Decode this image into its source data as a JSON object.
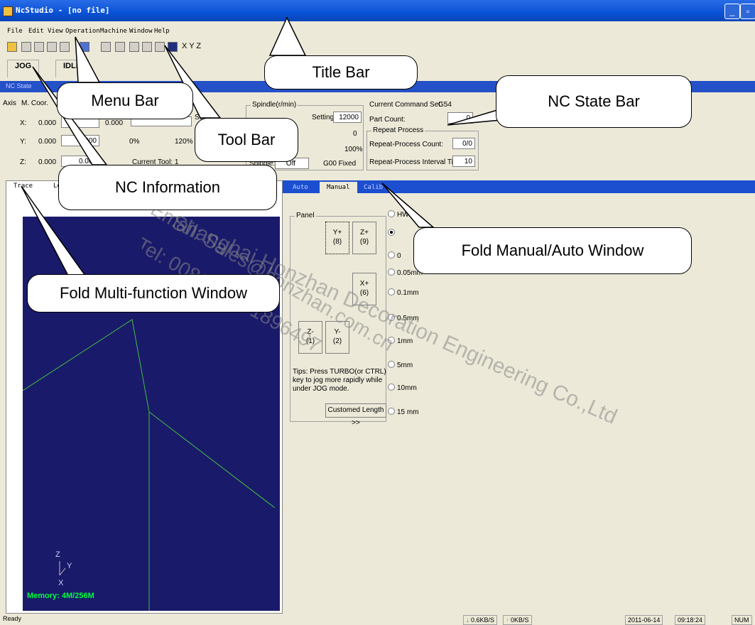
{
  "window": {
    "title": "NcStudio - [no file]"
  },
  "menu": [
    "File",
    "Edit",
    "View",
    "Operation",
    "Machine",
    "Window",
    "Help"
  ],
  "toolbar": {
    "axis_labels": "X   Y   Z"
  },
  "mode_tabs": [
    "JOG",
    "IDLE"
  ],
  "state_bar": {
    "label": "NC State"
  },
  "nc_info": {
    "axis_header": "Axis",
    "mcoor_header": "M. Coor.",
    "axes": [
      {
        "name": "X:",
        "mcoor": "0.000",
        "wcoor": "0.000"
      },
      {
        "name": "Y:",
        "mcoor": "0.000",
        "wcoor": "0.000"
      },
      {
        "name": "Z:",
        "mcoor": "0.000",
        "wcoor": "0.000"
      }
    ],
    "feed": {
      "setting_label": "Setting:",
      "pct_min": "0%",
      "pct_max": "120%",
      "current_tool": "Current Tool: 1"
    },
    "spindle": {
      "title": "Spindle(r/min)",
      "setting_label": "Setting:",
      "setting_value": "12000",
      "actual": "0",
      "percent": "100%",
      "spindle_label": "Spindle:",
      "spindle_state": "Off",
      "g00": "G00 Fixed"
    },
    "command": {
      "current_set_label": "Current Command Set:",
      "current_set_value": "G54",
      "part_count_label": "Part Count:",
      "part_count_value": "0",
      "repeat_title": "Repeat Process",
      "repeat_count_label": "Repeat-Process Count:",
      "repeat_count_value": "0/0",
      "repeat_interval_label": "Repeat-Process Interval Time:",
      "repeat_interval_value": "10"
    }
  },
  "left_panel": {
    "tabs": [
      "Trace",
      "Log"
    ],
    "memory": "Memory: 4M/256M",
    "axis_z": "Z",
    "axis_y": "Y",
    "axis_x": "X"
  },
  "right_panel": {
    "tabs": [
      "Auto",
      "Manual",
      "Calib"
    ],
    "panel_title": "Panel",
    "jog_buttons": [
      {
        "id": "yplus",
        "label": "Y+",
        "key": "(8)"
      },
      {
        "id": "zplus",
        "label": "Z+",
        "key": "(9)"
      },
      {
        "id": "xplus",
        "label": "X+",
        "key": "(6)"
      },
      {
        "id": "zminus",
        "label": "Z-",
        "key": "(1)"
      },
      {
        "id": "yminus",
        "label": "Y-",
        "key": "(2)"
      }
    ],
    "step_options": [
      "HW",
      "",
      "0",
      "0.05mm",
      "0.1mm",
      "0.5mm",
      "1mm",
      "5mm",
      "10mm",
      "15 mm"
    ],
    "tips": "Tips: Press TURBO(or CTRL) key to jog more rapidly while under JOG mode.",
    "customed_length": "Customed Length  >>"
  },
  "status_bar": {
    "ready": "Ready",
    "download": "0.6KB/S",
    "upload": "0KB/S",
    "date": "2011-06-14",
    "time": "09:18:24",
    "mode": "NUM"
  },
  "callouts": {
    "title_bar": "Title Bar",
    "menu_bar": "Menu Bar",
    "tool_bar": "Tool Bar",
    "nc_state_bar": "NC State Bar",
    "nc_information": "NC Information",
    "fold_manual_auto": "Fold Manual/Auto Window",
    "fold_multi": "Fold Multi-function Window"
  },
  "watermark": [
    "Shanghai Honzhan Decoration Engineering Co.,Ltd",
    "Email: Sales@honzhan.com.cn",
    "Tel: 0086-13681896497"
  ],
  "colors": {
    "titlebar": "#0a52d6",
    "statebar": "#2450c8",
    "viewport": "#1a1a6a",
    "trace": "#40c040",
    "memory": "#00ff40"
  }
}
